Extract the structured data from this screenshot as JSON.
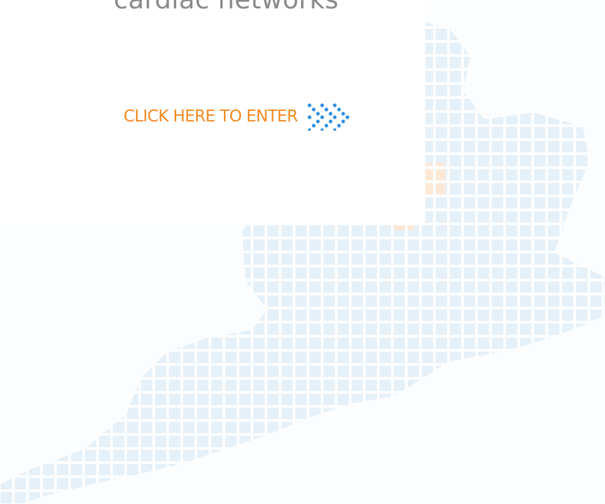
{
  "splash": {
    "tagline": "cardiac networks",
    "enter_link": {
      "label": "CLICK HERE TO ENTER",
      "icon": "dotted-arrows-icon"
    }
  },
  "colors": {
    "background": "#fcfdfe",
    "panel": "#ffffff",
    "tagline": "#8a8a8a",
    "enter_label": "#f28a22",
    "arrow_dots": "#2f8fe6",
    "map_tiles": "#e6f0f9",
    "map_highlight": "#fde8d6",
    "logo_accent": "#f5c21b"
  }
}
